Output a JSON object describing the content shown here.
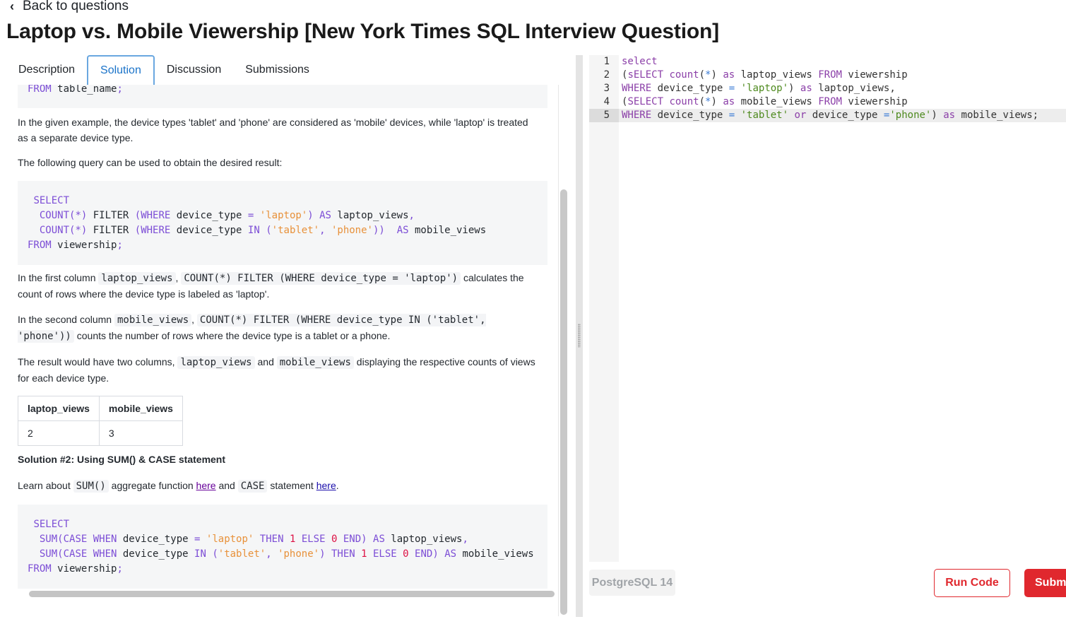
{
  "nav": {
    "back_label": "Back to questions"
  },
  "page": {
    "title": "Laptop vs. Mobile Viewership [New York Times SQL Interview Question]"
  },
  "tabs": [
    {
      "label": "Description",
      "active": false
    },
    {
      "label": "Solution",
      "active": true
    },
    {
      "label": "Discussion",
      "active": false
    },
    {
      "label": "Submissions",
      "active": false
    }
  ],
  "solution": {
    "top_code_line": "FROM table_name;",
    "para1": "In the given example, the device types 'tablet' and 'phone' are considered as 'mobile' devices, while 'laptop' is treated as a separate device type.",
    "para2": "The following query can be used to obtain the desired result:",
    "para3_a": "In the first column ",
    "para3_code1": "laptop_views",
    "para3_b": ", ",
    "para3_code2": "COUNT(*) FILTER (WHERE device_type = 'laptop')",
    "para3_c": " calculates the count of rows where the device type is labeled as 'laptop'.",
    "para4_a": "In the second column ",
    "para4_code1": "mobile_views",
    "para4_b": ", ",
    "para4_code2": "COUNT(*) FILTER (WHERE device_type IN ('tablet', 'phone'))",
    "para4_c": " counts the number of rows where the device type is a tablet or a phone.",
    "para5_a": "The result would have two columns, ",
    "para5_code1": "laptop_views",
    "para5_b": " and ",
    "para5_code2": "mobile_views",
    "para5_c": " displaying the respective counts of views for each device type.",
    "table": {
      "headers": [
        "laptop_views",
        "mobile_views"
      ],
      "row": [
        "2",
        "3"
      ]
    },
    "heading2": "Solution #2: Using SUM() & CASE statement",
    "para6_a": "Learn about ",
    "para6_code1": "SUM()",
    "para6_b": " aggregate function ",
    "para6_link1": "here",
    "para6_c": " and ",
    "para6_code2": "CASE",
    "para6_d": " statement ",
    "para6_link2": "here",
    "para6_e": "."
  },
  "editor": {
    "line_numbers": [
      "1",
      "2",
      "3",
      "4",
      "5"
    ],
    "active_line": 5,
    "language": "PostgreSQL 14",
    "run_label": "Run Code",
    "submit_label": "Submit"
  }
}
